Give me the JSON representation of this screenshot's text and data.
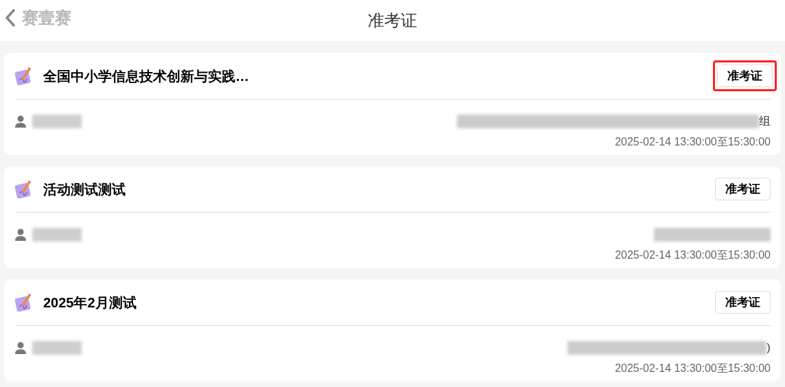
{
  "header": {
    "back_label": "赛壹赛",
    "title": "准考证"
  },
  "cards": [
    {
      "title": "全国中小学信息技术创新与实践…",
      "button": "准考证",
      "highlighted": true,
      "info_tail": "组",
      "time": "2025-02-14 13:30:00至15:30:00"
    },
    {
      "title": "活动测试测试",
      "button": "准考证",
      "highlighted": false,
      "time": "2025-02-14 13:30:00至15:30:00"
    },
    {
      "title": "2025年2月测试",
      "button": "准考证",
      "highlighted": false,
      "info_tail": ")",
      "time": "2025-02-14 13:30:00至15:30:00"
    }
  ]
}
